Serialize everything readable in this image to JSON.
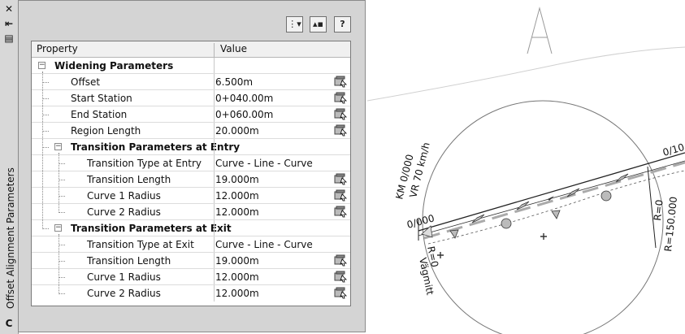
{
  "strip": {
    "title": "Offset Alignment Parameters",
    "close_glyph": "✕",
    "autohide_glyph": "⇤",
    "props_glyph": "▤",
    "bottom_glyph": "C"
  },
  "toolbar": {
    "btn1_glyph": "⋮▾",
    "btn2_glyph": "▴▪",
    "help_glyph": "?"
  },
  "grid": {
    "col_property": "Property",
    "col_value": "Value",
    "rows": [
      {
        "label": "Widening Parameters",
        "value": ""
      },
      {
        "label": "Offset",
        "value": "6.500m"
      },
      {
        "label": "Start Station",
        "value": "0+040.00m"
      },
      {
        "label": "End Station",
        "value": "0+060.00m"
      },
      {
        "label": "Region Length",
        "value": "20.000m"
      },
      {
        "label": "Transition Parameters at Entry",
        "value": ""
      },
      {
        "label": "Transition Type at Entry",
        "value": "Curve - Line - Curve"
      },
      {
        "label": "Transition Length",
        "value": "19.000m"
      },
      {
        "label": "Curve 1 Radius",
        "value": "12.000m"
      },
      {
        "label": "Curve 2 Radius",
        "value": "12.000m"
      },
      {
        "label": "Transition Parameters at Exit",
        "value": ""
      },
      {
        "label": "Transition Type at Exit",
        "value": "Curve - Line - Curve"
      },
      {
        "label": "Transition Length",
        "value": "19.000m"
      },
      {
        "label": "Curve 1 Radius",
        "value": "12.000m"
      },
      {
        "label": "Curve 2 Radius",
        "value": "12.000m"
      }
    ]
  },
  "drawing": {
    "vr_label": "VR 70 km/h",
    "km_label": "KM 0/000",
    "sta_start": "0/000",
    "sta_end": "0/10",
    "radius_label": "R=150.000",
    "r0_label": "R=0",
    "r0_label2": "R=0",
    "vagmitt_label": "Vägmitt"
  }
}
